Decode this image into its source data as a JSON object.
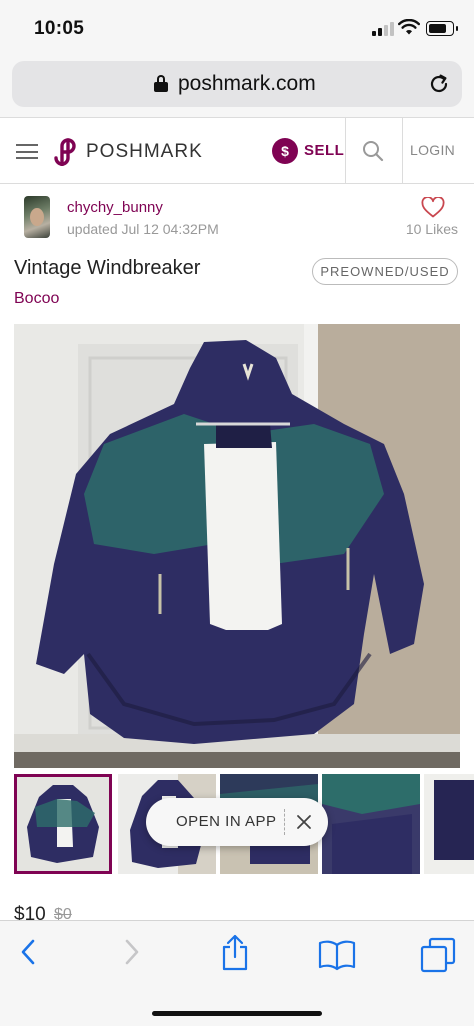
{
  "status_bar": {
    "time": "10:05",
    "signal_icon": "cellular-signal-icon",
    "wifi_icon": "wifi-icon",
    "battery_icon": "battery-icon",
    "battery_level": 0.8
  },
  "browser": {
    "domain": "poshmark.com",
    "lock_icon": "lock-icon",
    "reload_icon": "reload-icon"
  },
  "header": {
    "menu_icon": "hamburger-menu-icon",
    "logo_text": "POSHMARK",
    "sell_symbol": "$",
    "sell_label": "SELL",
    "search_icon": "search-icon",
    "login_label": "LOGIN"
  },
  "listing": {
    "seller_name": "chychy_bunny",
    "updated": "updated Jul 12 04:32PM",
    "likes_label": "10  Likes",
    "title": "Vintage Windbreaker",
    "condition": "PREOWNED/USED",
    "brand": "Bocoo",
    "price": "$10",
    "original_price": "$0",
    "thumbnail_count": 5,
    "selected_thumbnail": 1
  },
  "open_app": {
    "label": "OPEN IN APP",
    "close_icon": "close-icon"
  },
  "toolbar": {
    "back_icon": "back-chevron-icon",
    "forward_icon": "forward-chevron-icon",
    "share_icon": "share-icon",
    "bookmarks_icon": "bookmarks-book-icon",
    "tabs_icon": "tabs-icon"
  },
  "colors": {
    "brand": "#7f0353",
    "ios_blue": "#1a73e8",
    "jacket_navy": "#2e2d63",
    "jacket_teal": "#2d6d6a"
  }
}
